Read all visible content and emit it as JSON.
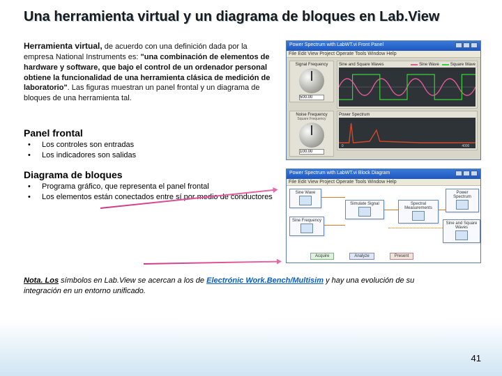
{
  "title": "Una herramienta virtual y un diagrama de bloques en Lab.View",
  "para": {
    "lead": "Herramienta virtual,",
    "t1": " de acuerdo con una definición dada por la empresa National Instruments es: ",
    "quote": "\"una combinación de elementos de hardware y software, que bajo el control de un ordenador personal obtiene la funcionalidad de una herramienta clásica de medición de laboratorio\"",
    "t2": ". Las figuras muestran un panel frontal y un diagrama de bloques de una herramienta tal."
  },
  "panel": {
    "head": "Panel frontal",
    "b1": "Los controles son entradas",
    "b2": "Los indicadores son salidas"
  },
  "diag": {
    "head": "Diagrama de bloques",
    "b1": "Programa gráfico, que representa el panel frontal",
    "b2": "Los elementos están conectados entre sí por medio de conductores"
  },
  "note": {
    "lead": "Nota. Los",
    "t1": " símbolos en Lab.View se acercan a los de ",
    "link": "Electrónic Work.Bench/Multisim",
    "t2": "  y hay una evolución de su integración en un entorno unificado."
  },
  "page": "41",
  "fp": {
    "title": "Power Spectrum with LabWT.vi Front Panel",
    "menu": "File Edit View Project Operate Tools Window Help",
    "knob1_label": "Signal Frequency",
    "knob1_val": "500.00",
    "knob2_label": "Noise Frequency",
    "knob2_sub": "Square Frequency",
    "knob2_val": "100.00",
    "g1_title": "Sine and Square Waves",
    "leg1a": "Sine Wave",
    "leg1b": "Square Wave",
    "g2_title": "Power Spectrum"
  },
  "bd": {
    "title": "Power Spectrum with LabWT.vi Block Diagram",
    "menu": "File Edit View Project Operate Tools Window Help",
    "b1": "Sine Wave",
    "b2": "Sine Frequency",
    "b3": "Simulate Signal",
    "b4": "Spectral Measurements",
    "b5": "Power Spectrum",
    "b6": "Sine and Square Waves",
    "btn1": "Acquire",
    "btn2": "Analyze",
    "btn3": "Present"
  }
}
